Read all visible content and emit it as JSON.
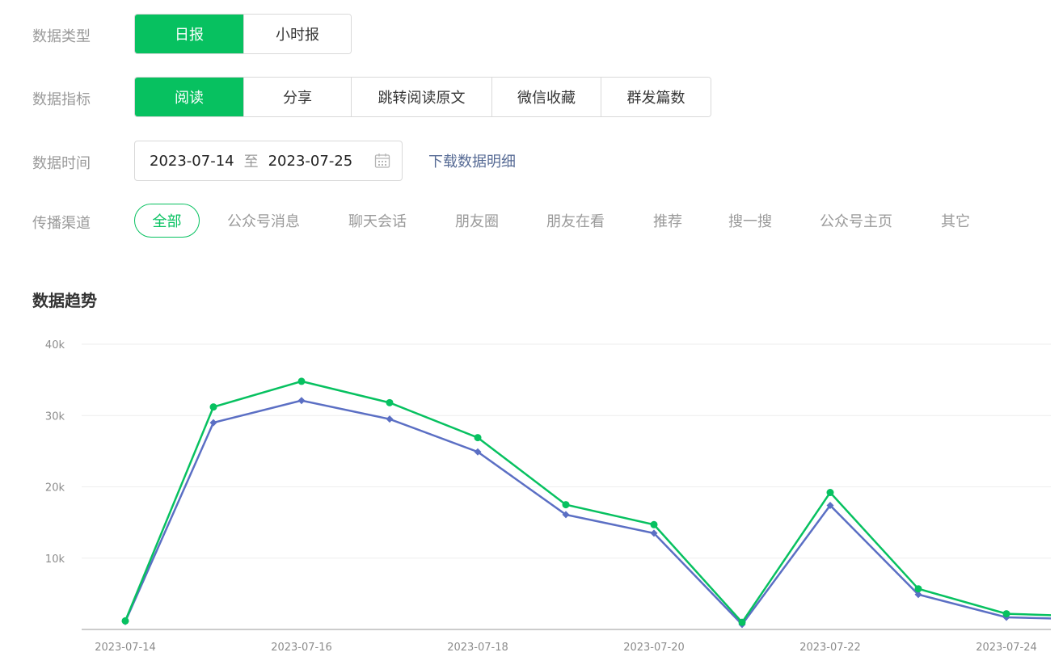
{
  "filters": {
    "data_type": {
      "label": "数据类型",
      "options": [
        "日报",
        "小时报"
      ],
      "selected": "日报"
    },
    "metric": {
      "label": "数据指标",
      "options": [
        "阅读",
        "分享",
        "跳转阅读原文",
        "微信收藏",
        "群发篇数"
      ],
      "selected": "阅读"
    },
    "date": {
      "label": "数据时间",
      "start": "2023-07-14",
      "separator": "至",
      "end": "2023-07-25",
      "calendar_icon": "calendar-icon"
    },
    "download_link": "下载数据明细",
    "channel": {
      "label": "传播渠道",
      "options": [
        "全部",
        "公众号消息",
        "聊天会话",
        "朋友圈",
        "朋友在看",
        "推荐",
        "搜一搜",
        "公众号主页",
        "其它"
      ],
      "selected": "全部"
    }
  },
  "section_title": "数据趋势",
  "colors": {
    "accent": "#07c160",
    "series_green": "#07c160",
    "series_blue": "#5b6fc4",
    "link": "#576b95"
  },
  "chart_data": {
    "type": "line",
    "x": [
      "2023-07-14",
      "2023-07-15",
      "2023-07-16",
      "2023-07-17",
      "2023-07-18",
      "2023-07-19",
      "2023-07-20",
      "2023-07-21",
      "2023-07-22",
      "2023-07-23",
      "2023-07-24",
      "2023-07-25"
    ],
    "x_tick_labels": [
      "2023-07-14",
      "2023-07-16",
      "2023-07-18",
      "2023-07-20",
      "2023-07-22",
      "2023-07-24"
    ],
    "y_tick_labels": [
      "10k",
      "20k",
      "30k",
      "40k"
    ],
    "ylim": [
      0,
      40000
    ],
    "grid": true,
    "series": [
      {
        "color": "#07c160",
        "marker": "circle",
        "values": [
          1200,
          31200,
          34800,
          31800,
          26900,
          17500,
          14700,
          1000,
          19200,
          5700,
          2200,
          1800
        ]
      },
      {
        "color": "#5b6fc4",
        "marker": "diamond",
        "values": [
          1100,
          29000,
          32100,
          29500,
          24900,
          16100,
          13500,
          700,
          17400,
          4900,
          1700,
          1400
        ]
      }
    ]
  }
}
